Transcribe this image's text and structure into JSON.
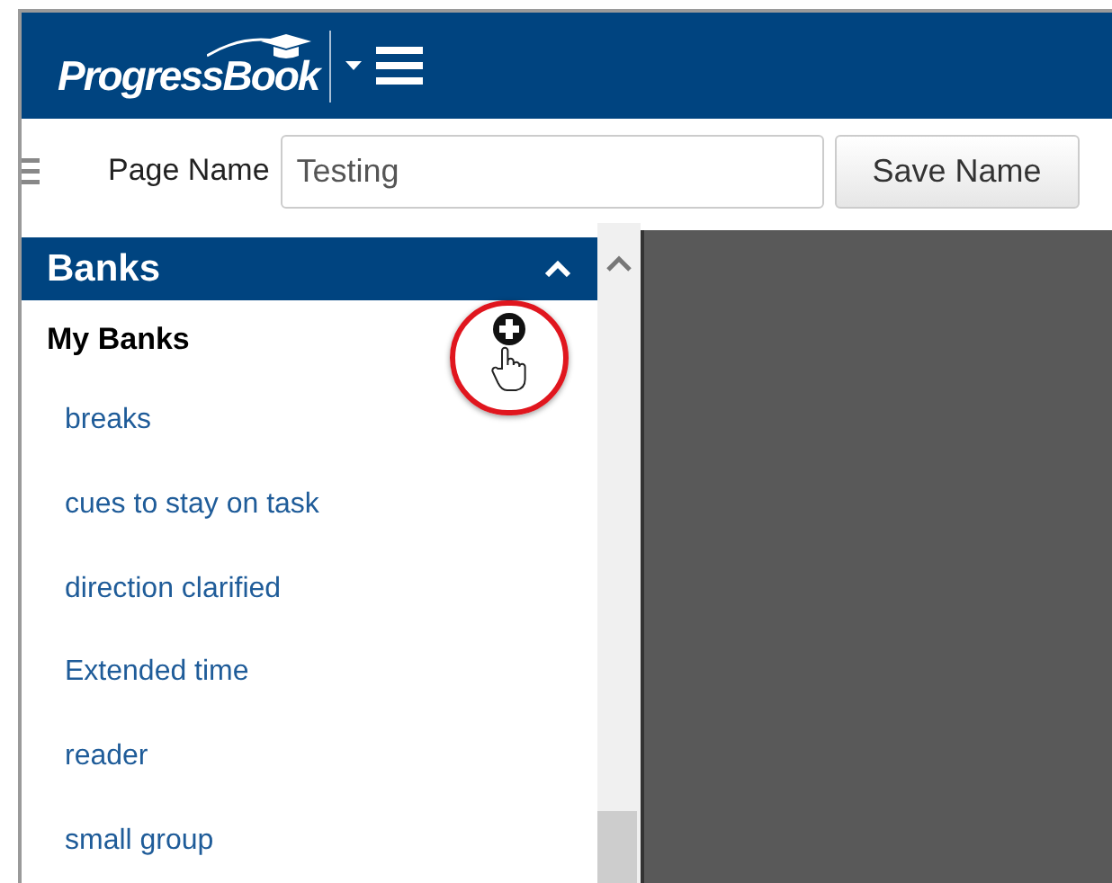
{
  "header": {
    "logo": "ProgressBook"
  },
  "toolbar": {
    "label": "Page Name",
    "field_value": "Testing",
    "button": "Save Name"
  },
  "panel": {
    "title": "Banks",
    "expanded": true,
    "section": "My Banks",
    "items": [
      "breaks",
      "cues to stay on task",
      "direction clarified",
      "Extended time",
      "reader",
      "small group"
    ]
  }
}
